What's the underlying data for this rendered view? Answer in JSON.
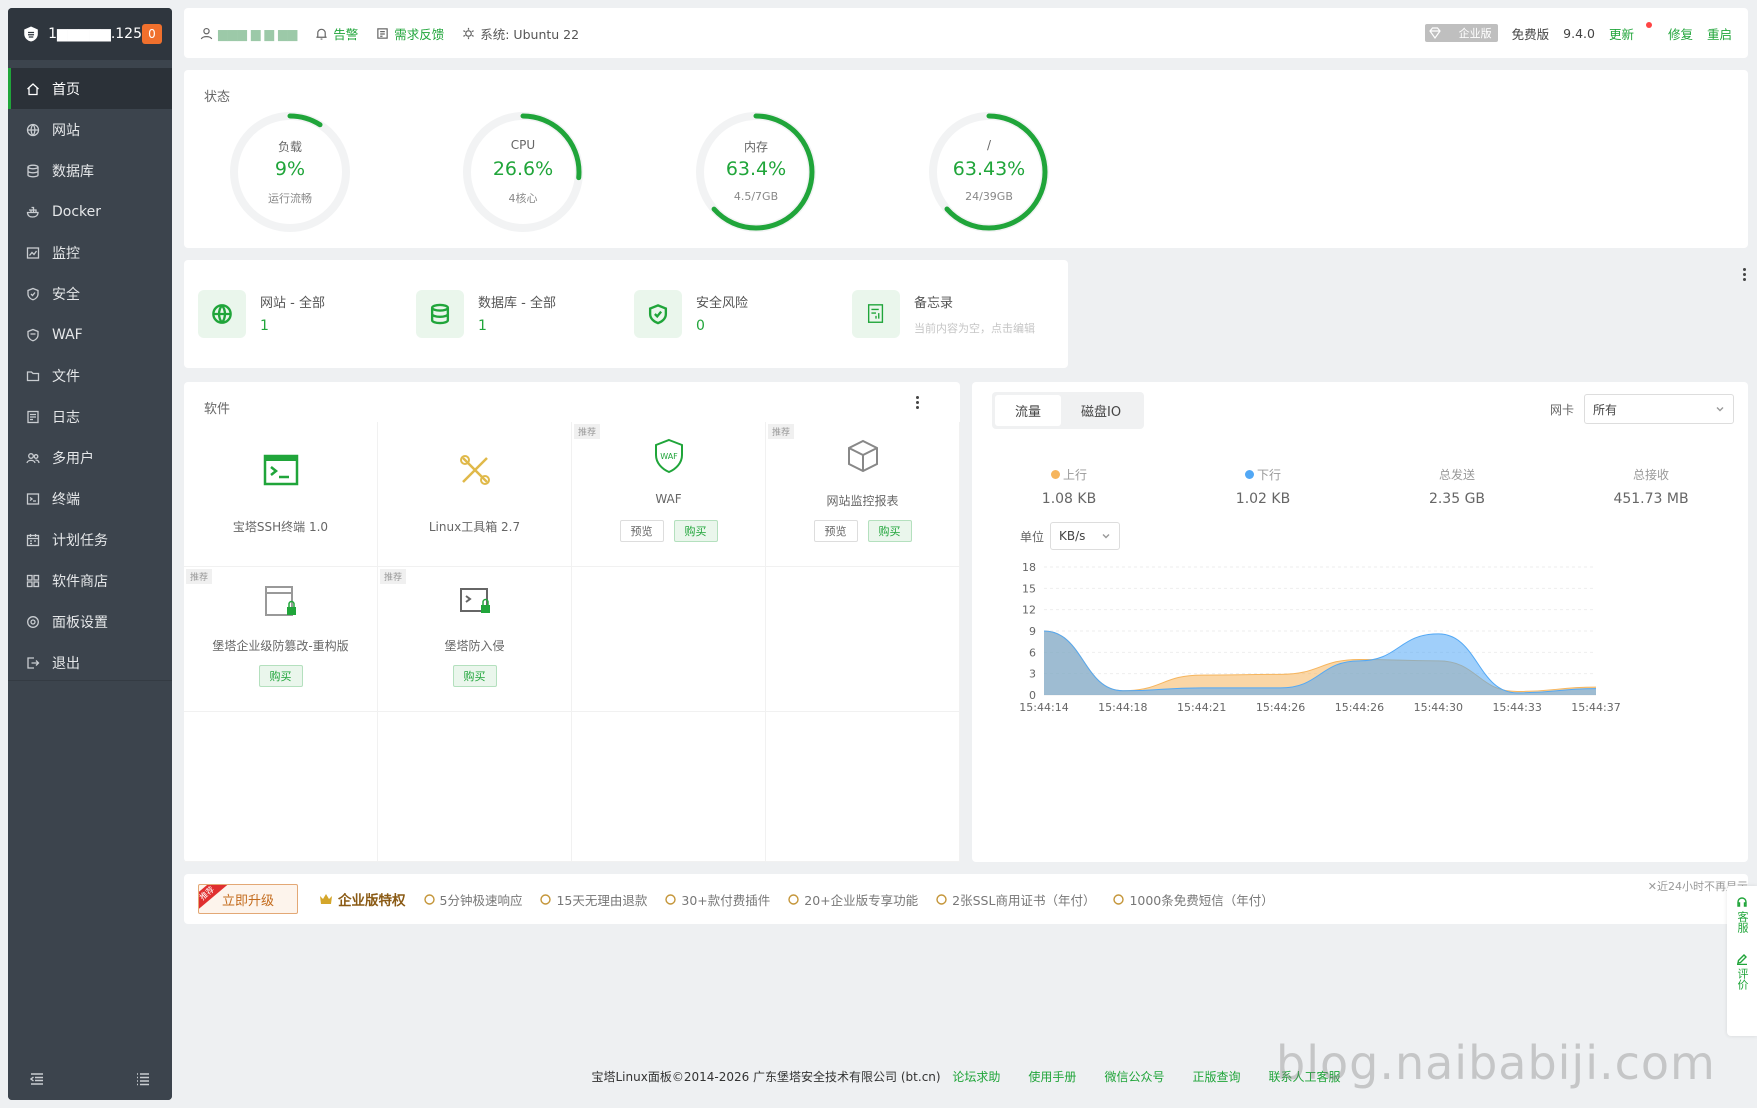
{
  "sidebar": {
    "host": "1▆▆▆▆▆.125",
    "badge": "0",
    "items": [
      {
        "label": "首页",
        "icon": "home-icon"
      },
      {
        "label": "网站",
        "icon": "globe-icon"
      },
      {
        "label": "数据库",
        "icon": "database-icon"
      },
      {
        "label": "Docker",
        "icon": "docker-icon"
      },
      {
        "label": "监控",
        "icon": "monitor-icon"
      },
      {
        "label": "安全",
        "icon": "shield-icon"
      },
      {
        "label": "WAF",
        "icon": "waf-shield-icon"
      },
      {
        "label": "文件",
        "icon": "folder-icon"
      },
      {
        "label": "日志",
        "icon": "log-icon"
      },
      {
        "label": "多用户",
        "icon": "users-icon"
      },
      {
        "label": "终端",
        "icon": "terminal-icon"
      },
      {
        "label": "计划任务",
        "icon": "calendar-icon"
      },
      {
        "label": "软件商店",
        "icon": "grid-icon"
      },
      {
        "label": "面板设置",
        "icon": "settings-icon"
      },
      {
        "label": "退出",
        "icon": "logout-icon"
      }
    ]
  },
  "topbar": {
    "user": "▆▆▆ ▆ ▆ ▆▆",
    "alarm": "告警",
    "feedback": "需求反馈",
    "system": "系统:  Ubuntu 22",
    "edition_badge": "企业版",
    "free_label": "免费版",
    "version": "9.4.0",
    "update": "更新",
    "repair": "修复",
    "restart": "重启"
  },
  "status": {
    "title": "状态",
    "gauges": [
      {
        "label": "负载",
        "value": "9%",
        "sub": "运行流畅",
        "percent": 9
      },
      {
        "label": "CPU",
        "value": "26.6%",
        "sub": "4核心",
        "percent": 26.6
      },
      {
        "label": "内存",
        "value": "63.4%",
        "sub": "4.5/7GB",
        "percent": 63.4
      },
      {
        "label": "/",
        "value": "63.43%",
        "sub": "24/39GB",
        "percent": 63.43
      }
    ]
  },
  "stats": [
    {
      "title": "网站 - 全部",
      "value": "1",
      "icon": "globe-icon"
    },
    {
      "title": "数据库 - 全部",
      "value": "1",
      "icon": "database-icon"
    },
    {
      "title": "安全风险",
      "value": "0",
      "icon": "shield-icon"
    },
    {
      "title": "备忘录",
      "hint": "当前内容为空，点击编辑",
      "icon": "memo-icon"
    }
  ],
  "software": {
    "title": "软件",
    "recommend_tag": "推荐",
    "preview_label": "预览",
    "buy_label": "购买",
    "items": [
      {
        "name": "宝塔SSH终端 1.0",
        "icon": "ssh-terminal-icon"
      },
      {
        "name": "Linux工具箱 2.7",
        "icon": "toolbox-icon"
      },
      {
        "name": "WAF",
        "icon": "waf-icon"
      },
      {
        "name": "网站监控报表",
        "icon": "cube-icon"
      },
      {
        "name": "堡塔企业级防篡改-重构版",
        "icon": "tamper-proof-icon"
      },
      {
        "name": "堡塔防入侵",
        "icon": "intrusion-icon"
      }
    ]
  },
  "traffic": {
    "tab_flow": "流量",
    "tab_disk": "磁盘IO",
    "nic_label": "网卡",
    "nic_value": "所有",
    "up_label": "上行",
    "up_value": "1.08 KB",
    "down_label": "下行",
    "down_value": "1.02 KB",
    "sent_label": "总发送",
    "sent_value": "2.35 GB",
    "recv_label": "总接收",
    "recv_value": "451.73 MB",
    "unit_label": "单位",
    "unit_value": "KB/s",
    "colors": {
      "up": "#f6b55d",
      "down": "#52a8f5"
    }
  },
  "chart_data": {
    "type": "area",
    "x": [
      "15:44:14",
      "15:44:18",
      "15:44:21",
      "15:44:26",
      "15:44:26",
      "15:44:30",
      "15:44:33",
      "15:44:37"
    ],
    "ylim": [
      0,
      18
    ],
    "yticks": [
      0,
      3,
      6,
      9,
      12,
      15,
      18
    ],
    "series": [
      {
        "name": "上行",
        "values": [
          9,
          0.6,
          2.8,
          2.9,
          5.0,
          4.8,
          0.5,
          1.1
        ]
      },
      {
        "name": "下行",
        "values": [
          9,
          0.6,
          1.0,
          1.0,
          4.8,
          8.6,
          0.3,
          0.9
        ]
      }
    ]
  },
  "promo": {
    "upgrade": "立即升级",
    "rec_tag": "推荐",
    "enterprise": "企业版特权",
    "items": [
      "5分钟极速响应",
      "15天无理由退款",
      "30+款付费插件",
      "20+企业版专享功能",
      "2张SSL商用证书（年付）",
      "1000条免费短信（年付）"
    ],
    "close": "近24小时不再显示"
  },
  "sidetool": {
    "service": "客服",
    "review": "评价"
  },
  "footer": {
    "copyright": "宝塔Linux面板©2014-2026 广东堡塔安全技术有限公司 (bt.cn)",
    "links": [
      "论坛求助",
      "使用手册",
      "微信公众号",
      "正版查询",
      "联系人工客服"
    ]
  },
  "watermark": "blog.naibabiji.com"
}
